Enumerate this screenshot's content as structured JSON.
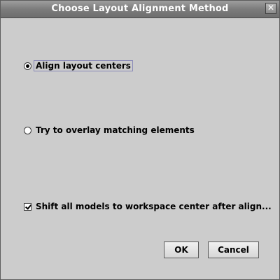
{
  "window": {
    "title": "Choose Layout Alignment Method",
    "close_glyph": "✕"
  },
  "options": {
    "align_centers": {
      "label": "Align layout centers",
      "selected": true
    },
    "overlay_matching": {
      "label": "Try to overlay matching elements",
      "selected": false
    }
  },
  "shift_models": {
    "label": "Shift all models to workspace center after align...",
    "checked": true
  },
  "buttons": {
    "ok": "OK",
    "cancel": "Cancel"
  }
}
